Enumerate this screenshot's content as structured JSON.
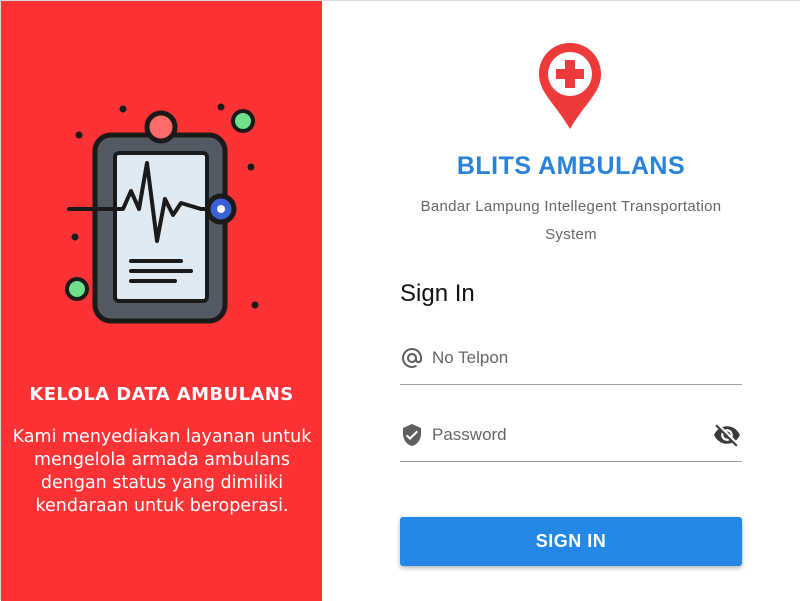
{
  "left_panel": {
    "title": "KELOLA DATA AMBULANS",
    "description": "Kami menyediakan layanan untuk mengelola armada ambulans dengan status yang dimiliki kendaraan untuk beroperasi.",
    "background_color": "#fc3234",
    "illustration_icon": "medical-tablet-heartbeat-icon"
  },
  "brand": {
    "logo_icon": "location-pin-plus-icon",
    "title": "BLITS AMBULANS",
    "subtitle": "Bandar Lampung Intellegent Transportation System",
    "accent_color": "#2a83d9"
  },
  "form": {
    "heading": "Sign In",
    "phone": {
      "placeholder": "No Telpon",
      "value": "",
      "icon": "at-sign-icon"
    },
    "password": {
      "placeholder": "Password",
      "value": "",
      "icon": "shield-check-icon",
      "toggle_icon": "eye-off-icon"
    },
    "submit_label": "SIGN IN",
    "button_color": "#2387e6"
  }
}
